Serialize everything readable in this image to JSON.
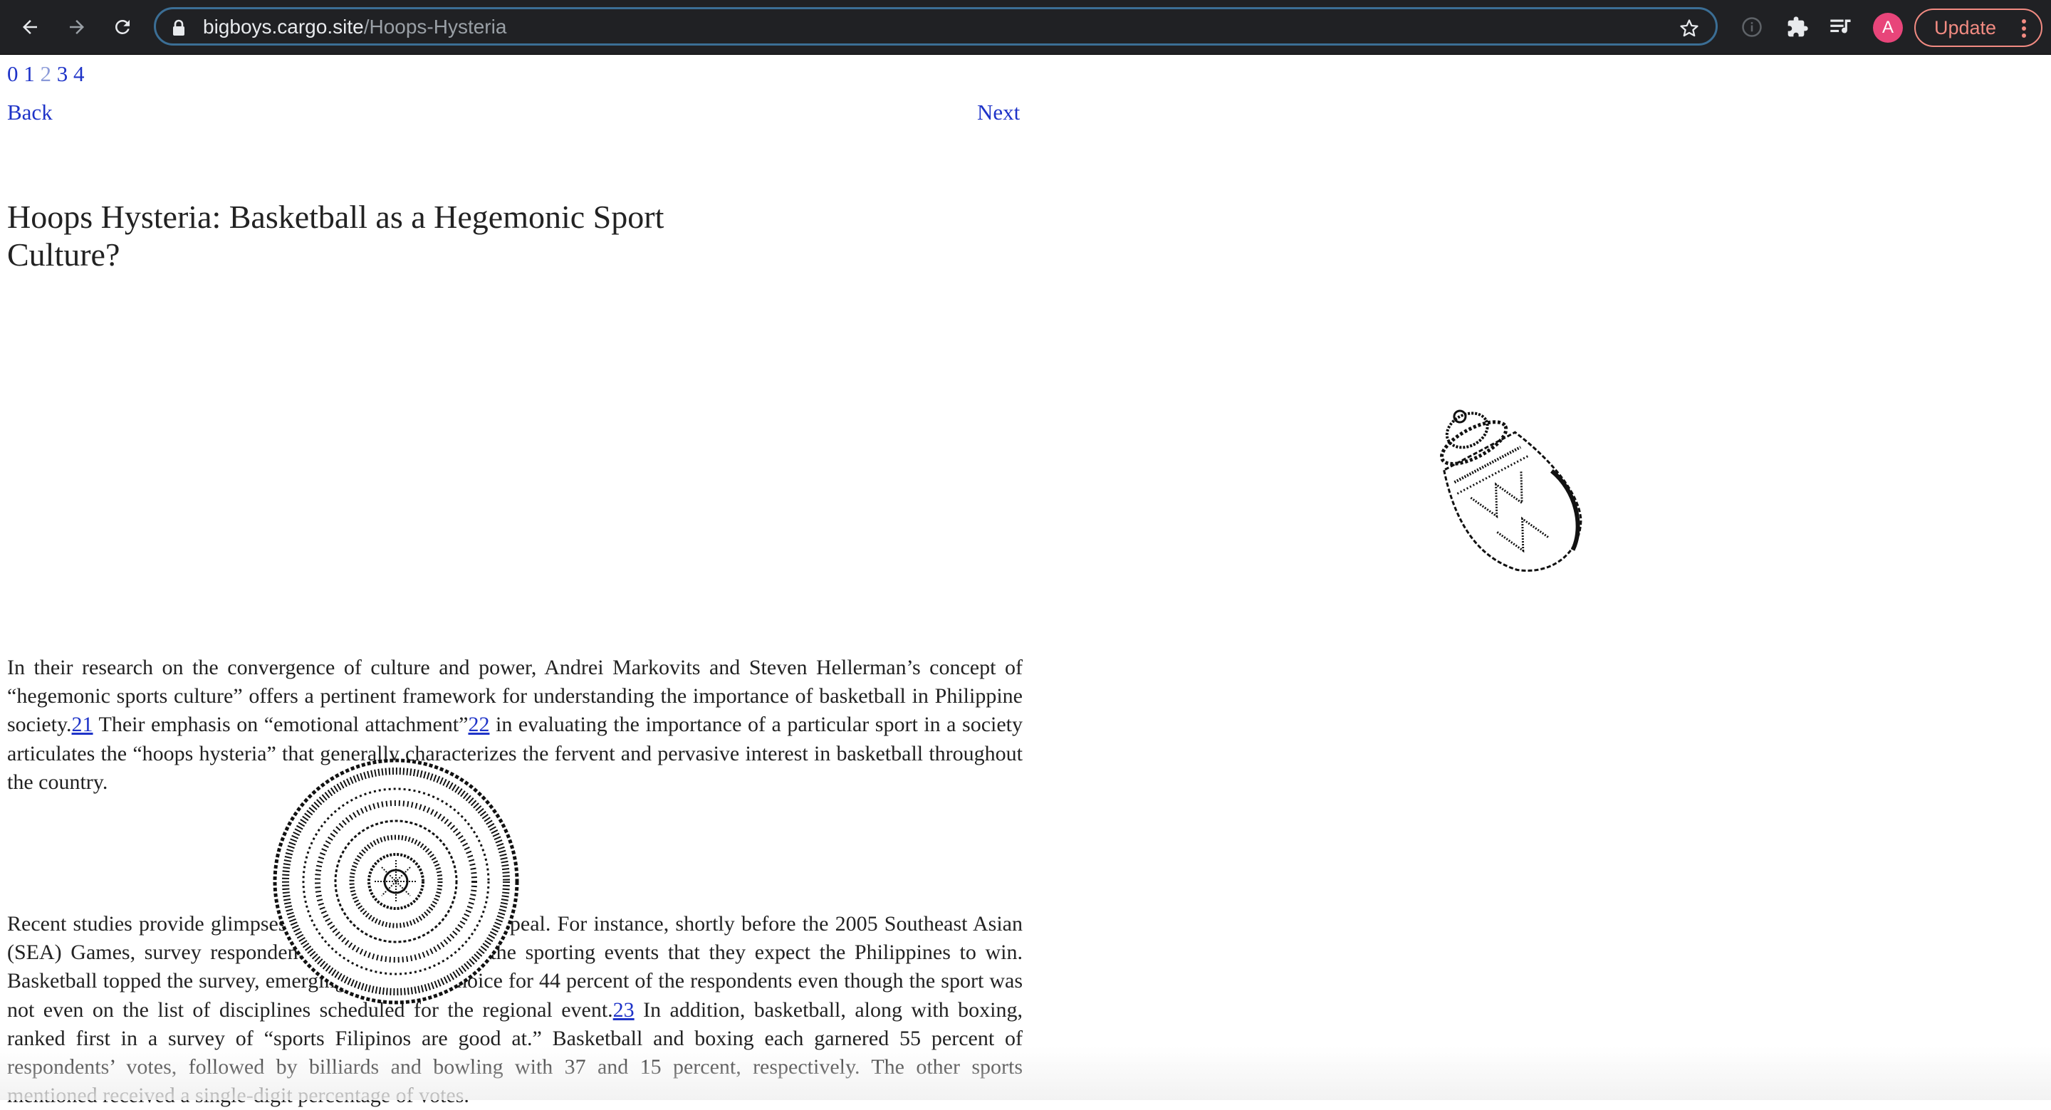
{
  "browser": {
    "url_host": "bigboys.cargo.site",
    "url_path": "/Hoops-Hysteria",
    "profile_initial": "A",
    "update_label": "Update",
    "accent_update": "#f28b82",
    "avatar_color": "#e8457a"
  },
  "nav": {
    "pages": [
      "0",
      "1",
      "2",
      "3",
      "4"
    ],
    "current_page": "2",
    "back_label": "Back",
    "next_label": "Next"
  },
  "article": {
    "title": "Hoops Hysteria: Basketball as a Hegemonic Sport Culture?",
    "p1": {
      "a": "In their research on the convergence of culture and power, Andrei Markovits and Steven Hellerman’s concept of “hegemonic sports culture” offers a pertinent framework for understanding the importance of basketball in Philippine society.",
      "fn1": "21",
      "b": " Their emphasis on “emotional attachment”",
      "fn2": "22",
      "c": " in evaluating the importance of a particular sport in a society articulates the “hoops hysteria” that generally characterizes the fervent and pervasive interest in basketball throughout the country."
    },
    "p2": {
      "a": "Recent studies provide glimpses into basketball’s mass appeal. For instance, shortly before the 2005 Southeast Asian (SEA) Games, survey respondents were asked to list the sporting events that they expect the Philippines to win. Basketball topped the survey, emerging as the first choice for 44 percent of the respondents even though the sport was not even on the list of disciplines scheduled for the regional event.",
      "fn1": "23",
      "b": " In addition, basketball, along with boxing, ranked first in a survey of “sports Filipinos are good at.” Basketball and boxing each garnered 55 percent of respondents’ votes, followed by billiards and bowling with 37 and 15 percent, respectively. The other sports mentioned received a single-digit percentage of votes."
    }
  }
}
